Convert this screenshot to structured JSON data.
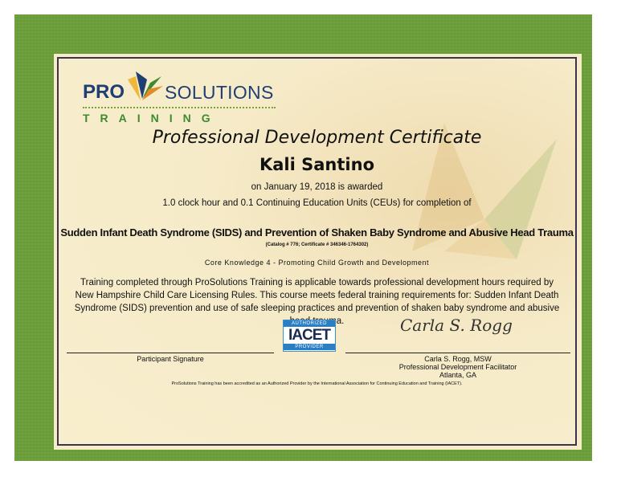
{
  "logo": {
    "pro": "PRO",
    "solutions": "SOLUTIONS",
    "training": "TRAINING"
  },
  "certificate": {
    "title": "Professional Development Certificate",
    "recipient": "Kali Santino",
    "date_line": "on January 19, 2018 is awarded",
    "hours_line": "1.0 clock hour and 0.1 Continuing Education Units (CEUs) for completion of",
    "course": "Sudden Infant Death Syndrome (SIDS) and Prevention of Shaken Baby Syndrome and Abusive Head Trauma",
    "catalog": "(Catalog # 776; Certificate # 346346-1764302)",
    "core_knowledge": "Core Knowledge 4 - Promoting Child Growth and Development",
    "description": "Training completed through ProSolutions Training is applicable towards professional development hours required by New Hampshire Child Care Licensing Rules. This course meets federal training requirements for: Sudden Infant Death Syndrome (SIDS) prevention and use of safe sleeping practices and prevention of shaken baby syndrome and abusive head trauma."
  },
  "badge": {
    "top": "AUTHORIZED",
    "main": "IACET",
    "bottom": "PROVIDER"
  },
  "signatures": {
    "participant_label": "Participant Signature",
    "facilitator_signature": "Carla S. Rogg",
    "facilitator_name": "Carla S. Rogg, MSW",
    "facilitator_title": "Professional Development Facilitator",
    "facilitator_location": "Atlanta, GA"
  },
  "footer": "ProSolutions Training has been accredited as an Authorized Provider by the International Association for Continuing Education and Training (IACET).",
  "colors": {
    "border": "#6a9c3a",
    "paper": "#f7ecc8",
    "navy": "#1f3f74",
    "green": "#3f8a2e"
  }
}
